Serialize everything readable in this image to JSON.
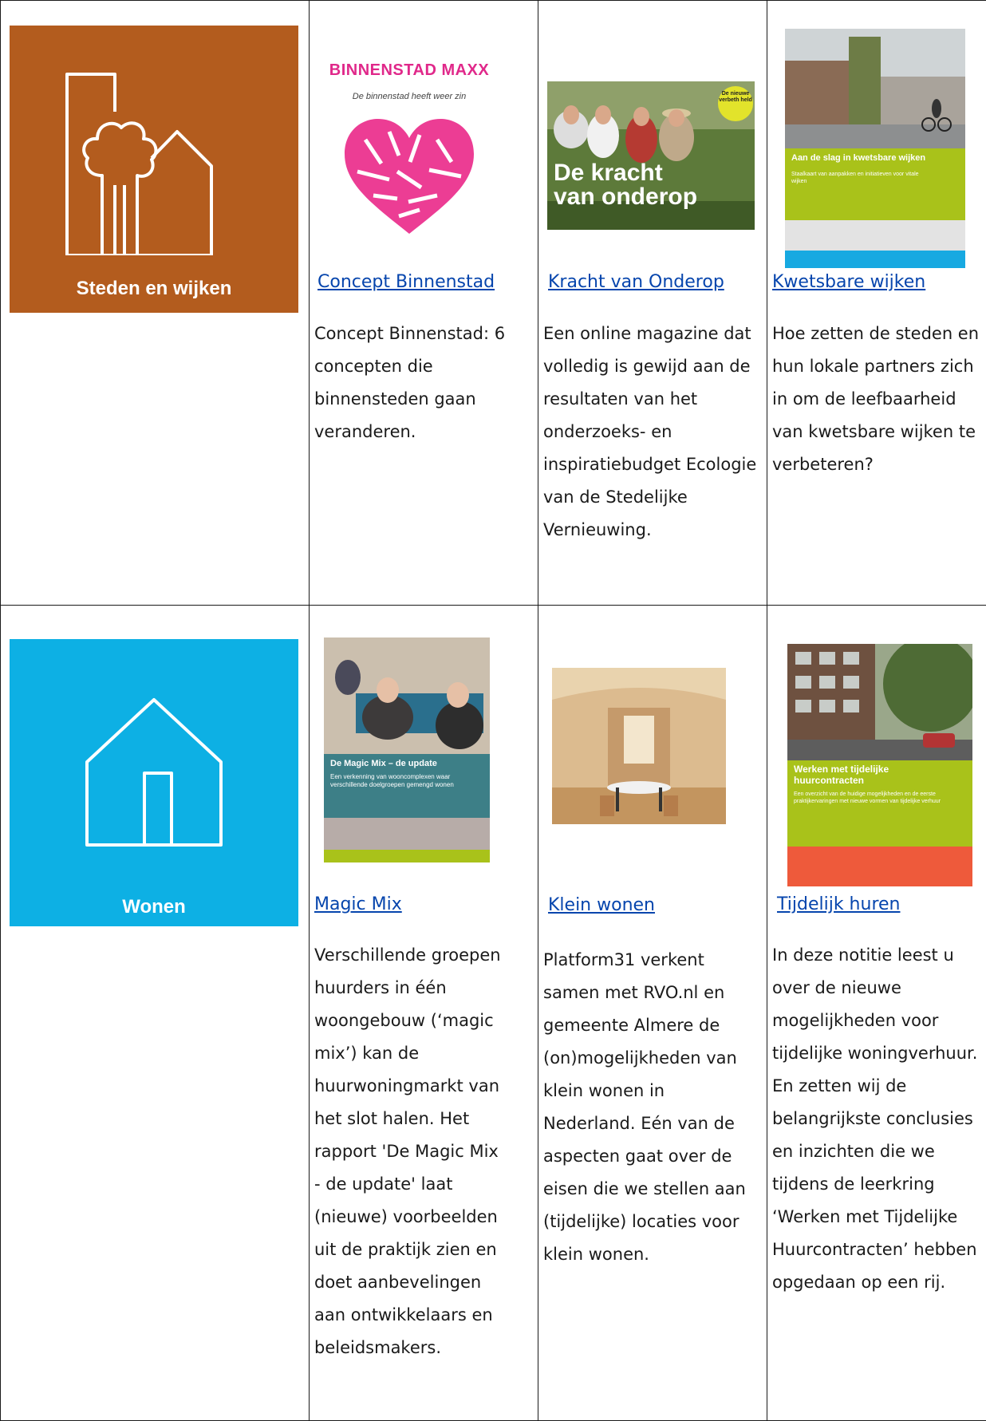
{
  "categories": [
    {
      "label": "Steden en wijken",
      "color": "#b35c1e",
      "icon": "tree-house-icon"
    },
    {
      "label": "Wonen",
      "color": "#0db0e4",
      "icon": "house-icon"
    }
  ],
  "rows": [
    [
      {
        "thumb_title": "BINNENSTAD MAXX",
        "thumb_subtitle": "De binnenstad heeft weer zin",
        "link": "Concept Binnenstad",
        "desc": "Concept Binnenstad: 6 concepten die binnensteden gaan veranderen."
      },
      {
        "thumb_title": "De kracht van onderop",
        "thumb_badge": "De nieuwe verbeth held",
        "link": "Kracht van Onderop",
        "desc": "Een online magazine dat volledig is gewijd aan de resultaten van het onderzoeks- en inspiratiebudget Ecologie van de Stedelijke Vernieuwing."
      },
      {
        "thumb_title": "Aan de slag in kwetsbare wijken",
        "thumb_subtitle": "Staalkaart van aanpakken en initiatieven voor vitale wijken",
        "link": "Kwetsbare wijken",
        "desc": "Hoe zetten de steden en hun lokale partners zich in om de leefbaarheid van kwetsbare wijken te verbeteren?"
      }
    ],
    [
      {
        "thumb_title": "De Magic Mix – de update",
        "thumb_subtitle": "Een verkenning van wooncomplexen waar verschillende doelgroepen gemengd wonen",
        "link": "Magic Mix",
        "desc": "Verschillende groepen huurders in één woongebouw (‘magic mix’) kan de huurwoningmarkt van het slot halen. Het rapport 'De Magic Mix - de update' laat (nieuwe) voorbeelden uit de praktijk zien en doet aanbevelingen aan ontwikkelaars en beleidsmakers."
      },
      {
        "link": "Klein wonen",
        "desc": "Platform31 verkent samen met RVO.nl en gemeente Almere de (on)mogelijkheden van klein wonen in Nederland. Eén van de aspecten gaat over de eisen die we stellen aan (tijdelijke) locaties voor klein wonen."
      },
      {
        "thumb_title": "Werken met tijdelijke huurcontracten",
        "thumb_subtitle": "Een overzicht van de huidige mogelijkheden en de eerste praktijkervaringen met nieuwe vormen van tijdelijke verhuur",
        "link": "Tijdelijk huren",
        "desc": "In deze notitie leest u over de nieuwe mogelijkheden voor tijdelijke woningverhuur. En zetten wij de belangrijkste conclusies en inzichten die we tijdens de leerkring ‘Werken met Tijdelijke Huurcontracten’ hebben opgedaan op een rij."
      }
    ]
  ]
}
